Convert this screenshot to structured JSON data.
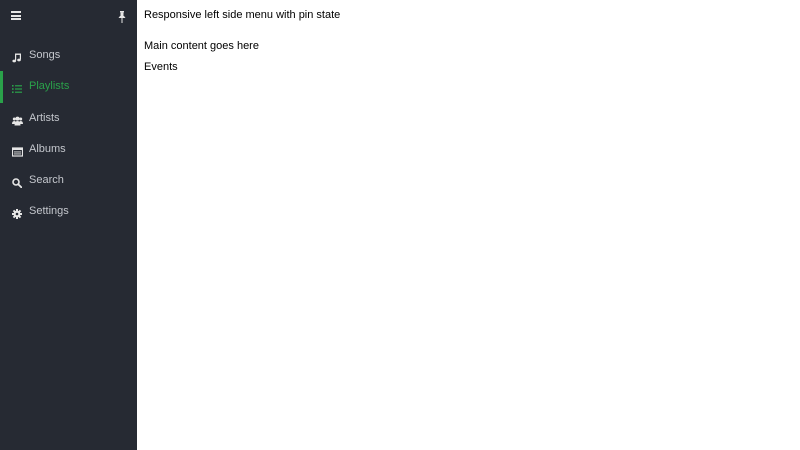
{
  "sidebar": {
    "menu_icon": "hamburger-icon",
    "pin_icon": "pin-icon",
    "items": [
      {
        "label": "Songs",
        "icon": "music-note-icon",
        "active": false
      },
      {
        "label": "Playlists",
        "icon": "list-icon",
        "active": true
      },
      {
        "label": "Artists",
        "icon": "users-icon",
        "active": false
      },
      {
        "label": "Albums",
        "icon": "album-icon",
        "active": false
      },
      {
        "label": "Search",
        "icon": "search-icon",
        "active": false
      },
      {
        "label": "Settings",
        "icon": "gear-icon",
        "active": false
      }
    ]
  },
  "main": {
    "title": "Responsive left side menu with pin state",
    "content": "Main content goes here",
    "events": "Events"
  },
  "colors": {
    "sidebar_bg": "#262a33",
    "accent": "#2aa14a",
    "menu_text": "#c4c7cd",
    "icon": "#e6e6e6"
  }
}
